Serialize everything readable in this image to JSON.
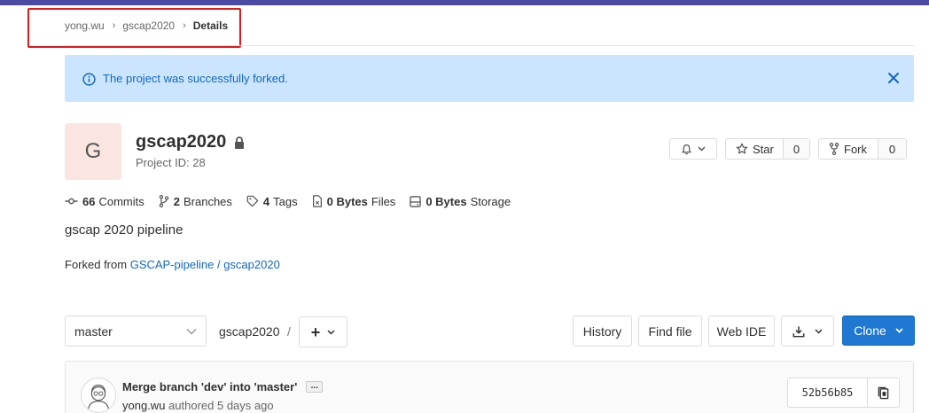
{
  "colors": {
    "accent": "#1f78d1",
    "alert_bg": "#cce5ff",
    "topbar": "#4b4ba3",
    "highlight": "#e0191a",
    "avatar_bg": "#fbe5e1"
  },
  "breadcrumb": {
    "items": [
      "yong.wu",
      "gscap2020"
    ],
    "current": "Details"
  },
  "alert": {
    "message": "The project was successfully forked.",
    "icon": "info-icon"
  },
  "project": {
    "avatar_letter": "G",
    "name": "gscap2020",
    "id_text": "Project ID: 28",
    "description": "gscap 2020 pipeline"
  },
  "actions": {
    "star_label": "Star",
    "star_count": "0",
    "fork_label": "Fork",
    "fork_count": "0"
  },
  "stats": {
    "commits_count": "66",
    "commits_label": "Commits",
    "branches_count": "2",
    "branches_label": "Branches",
    "tags_count": "4",
    "tags_label": "Tags",
    "files_size": "0 Bytes",
    "files_label": "Files",
    "storage_size": "0 Bytes",
    "storage_label": "Storage"
  },
  "fork_info": {
    "prefix": "Forked from",
    "link": "GSCAP-pipeline / gscap2020"
  },
  "repo_nav": {
    "branch": "master",
    "path_root": "gscap2020",
    "path_sep": "/",
    "add_label": "+",
    "history": "History",
    "find_file": "Find file",
    "web_ide": "Web IDE",
    "clone": "Clone"
  },
  "commit": {
    "title": "Merge branch 'dev' into 'master'",
    "ellipsis": "...",
    "author": "yong.wu",
    "authored_text": "authored 5 days ago",
    "sha": "52b56b85"
  }
}
